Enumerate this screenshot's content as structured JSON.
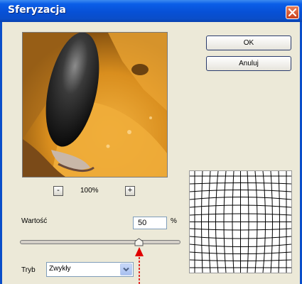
{
  "window": {
    "title": "Sferyzacja"
  },
  "buttons": {
    "ok": "OK",
    "cancel": "Anuluj"
  },
  "zoom": {
    "minus": "-",
    "plus": "+",
    "level": "100%"
  },
  "amount": {
    "label": "Wartość",
    "value": "50",
    "unit": "%",
    "slider_fraction": 0.75
  },
  "mode": {
    "label": "Tryb",
    "selected": "Zwykły"
  },
  "colors": {
    "title_bar": "#0a4ec9",
    "dialog_bg": "#ece9d8",
    "annotation": "#e00000"
  }
}
